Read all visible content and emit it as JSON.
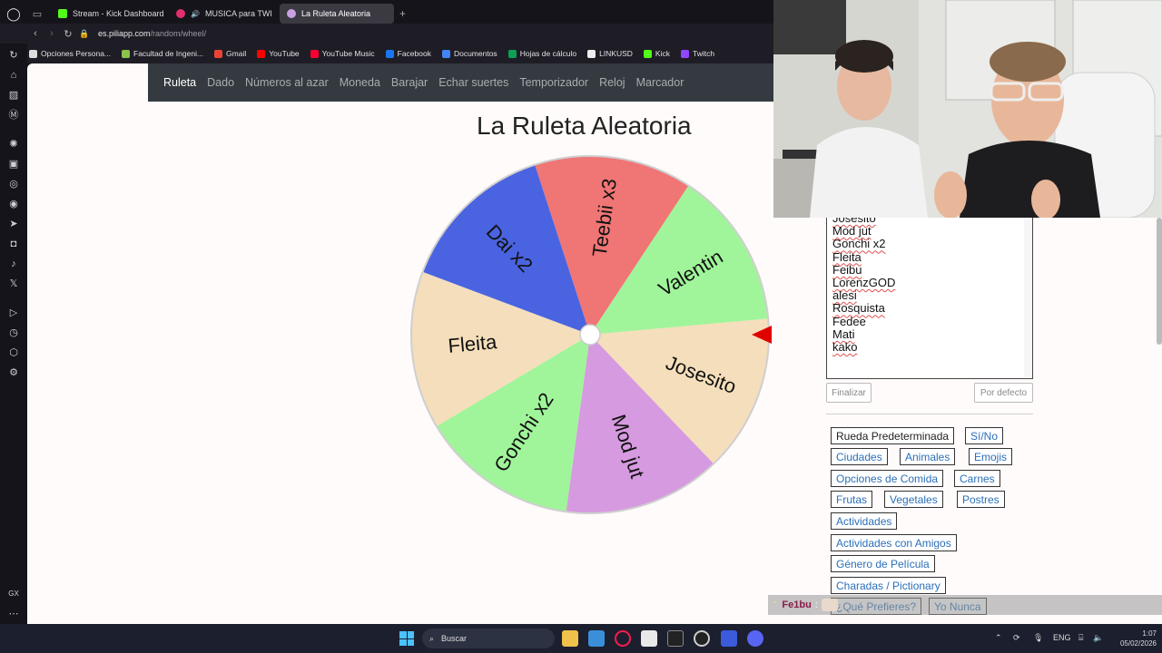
{
  "browser": {
    "tabs": [
      {
        "label": "Stream - Kick Dashboard",
        "color": "#53fc18",
        "active": false
      },
      {
        "label": "MUSICA para TWI",
        "color": "#e1306c",
        "active": false
      },
      {
        "label": "La Ruleta Aleatoria",
        "color": "#9b59b6",
        "active": true
      }
    ],
    "url_host": "es.piliapp.com",
    "url_path": "/random/wheel/",
    "bookmarks": [
      {
        "label": "Opciones Persona...",
        "color": "#dddddd"
      },
      {
        "label": "Facultad de Ingeni...",
        "color": "#8bc34a"
      },
      {
        "label": "Gmail",
        "color": "#ea4335"
      },
      {
        "label": "YouTube",
        "color": "#ff0000"
      },
      {
        "label": "YouTube Music",
        "color": "#ff0033"
      },
      {
        "label": "Facebook",
        "color": "#1877f2"
      },
      {
        "label": "Documentos",
        "color": "#4285f4"
      },
      {
        "label": "Hojas de cálculo",
        "color": "#0f9d58"
      },
      {
        "label": "LINKUSD",
        "color": "#eeeeee"
      },
      {
        "label": "Kick",
        "color": "#53fc18"
      },
      {
        "label": "Twitch",
        "color": "#9146ff"
      }
    ]
  },
  "nav": {
    "items": [
      "Ruleta",
      "Dado",
      "Números al azar",
      "Moneda",
      "Barajar",
      "Echar suertes",
      "Temporizador",
      "Reloj",
      "Marcador"
    ]
  },
  "page": {
    "title": "La Ruleta Aleatoria"
  },
  "wheel": {
    "segments": [
      {
        "label": "Teebii x3",
        "color": "#f07575"
      },
      {
        "label": "Valentin",
        "color": "#a0f59a"
      },
      {
        "label": "Josesito",
        "color": "#f5debb"
      },
      {
        "label": "Mod jut",
        "color": "#d69ae0"
      },
      {
        "label": "Gonchi x2",
        "color": "#a0f59a"
      },
      {
        "label": "Fleita",
        "color": "#f5debb"
      },
      {
        "label": "Dai x2",
        "color": "#4a63e0"
      }
    ],
    "pointer_color": "#e00000"
  },
  "names": {
    "lines": [
      "Josesito",
      "Mod jut",
      "Gonchi x2",
      "Fleita",
      "Feibu",
      "LorenzGOD",
      "alesi",
      "Rosquista",
      "Fedee",
      "Mati",
      "kako"
    ],
    "finalize_label": "Finalizar",
    "default_label": "Por defecto"
  },
  "presets": {
    "items": [
      "Rueda Predeterminada",
      "Sí/No",
      "Ciudades",
      "Animales",
      "Emojis",
      "Opciones de Comida",
      "Carnes",
      "Frutas",
      "Vegetales",
      "Postres",
      "Actividades",
      "Actividades con Amigos",
      "Género de Película",
      "Charadas / Pictionary",
      "¿Qué Prefieres?",
      "Yo Nunca"
    ]
  },
  "chat": {
    "user": "Fe1bu",
    "colon": ":"
  },
  "taskbar": {
    "search_placeholder": "Buscar",
    "lang": "ENG",
    "time": "1:07",
    "date": "05/02/2026"
  }
}
